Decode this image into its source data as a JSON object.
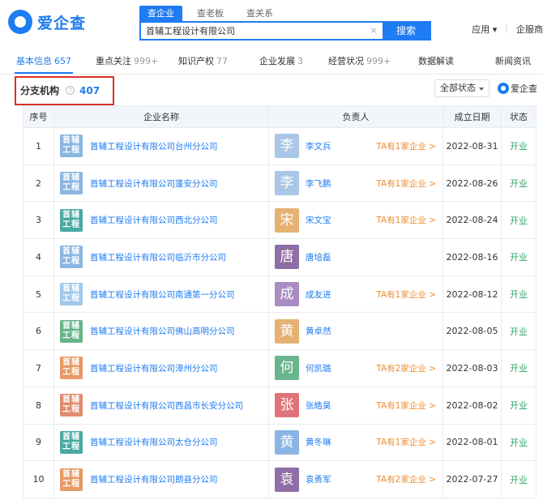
{
  "header": {
    "logo_text": "爱企查",
    "search_tabs": [
      "查企业",
      "查老板",
      "查关系"
    ],
    "search_value": "首辅工程设计有限公司",
    "search_button": "搜索",
    "clear_icon": "×",
    "right_items": [
      "应用",
      "企服商"
    ]
  },
  "nav": {
    "tabs": [
      {
        "label": "基本信息",
        "count": "657"
      },
      {
        "label": "重点关注",
        "count": "999+"
      },
      {
        "label": "知识产权",
        "count": "77"
      },
      {
        "label": "企业发展",
        "count": "3"
      },
      {
        "label": "经营状况",
        "count": "999+"
      },
      {
        "label": "数据解读",
        "count": ""
      },
      {
        "label": "新闻资讯",
        "count": ""
      }
    ]
  },
  "section": {
    "title": "分支机构",
    "help": "?",
    "count": "407",
    "status_filter": "全部状态",
    "watermark": "爱企查"
  },
  "table": {
    "headers": [
      "序号",
      "企业名称",
      "负责人",
      "成立日期",
      "状态"
    ],
    "logo_text": [
      "首辅",
      "工程"
    ],
    "rows": [
      {
        "no": "1",
        "company": "首辅工程设计有限公司台州分公司",
        "logo_color": "#8bb6e0",
        "avatar": "李",
        "avatar_color": "#a9c6e6",
        "person": "李文兵",
        "ta": "TA有1家企业 >",
        "date": "2022-08-31",
        "status": "开业"
      },
      {
        "no": "2",
        "company": "首辅工程设计有限公司蓬安分公司",
        "logo_color": "#8bb6e0",
        "avatar": "李",
        "avatar_color": "#a9c6e6",
        "person": "李飞鹏",
        "ta": "TA有1家企业 >",
        "date": "2022-08-26",
        "status": "开业"
      },
      {
        "no": "3",
        "company": "首辅工程设计有限公司西北分公司",
        "logo_color": "#4aa9a3",
        "avatar": "宋",
        "avatar_color": "#e5b274",
        "person": "宋文宝",
        "ta": "TA有1家企业 >",
        "date": "2022-08-24",
        "status": "开业"
      },
      {
        "no": "4",
        "company": "首辅工程设计有限公司临沂市分公司",
        "logo_color": "#8bb6e0",
        "avatar": "唐",
        "avatar_color": "#8e6ea5",
        "person": "唐培磊",
        "ta": "",
        "date": "2022-08-16",
        "status": "开业"
      },
      {
        "no": "5",
        "company": "首辅工程设计有限公司南通第一分公司",
        "logo_color": "#9ec9ec",
        "avatar": "成",
        "avatar_color": "#a98cc2",
        "person": "成友进",
        "ta": "TA有1家企业 >",
        "date": "2022-08-12",
        "status": "开业"
      },
      {
        "no": "6",
        "company": "首辅工程设计有限公司佛山高明分公司",
        "logo_color": "#67b58a",
        "avatar": "黄",
        "avatar_color": "#e5b274",
        "person": "黄卓然",
        "ta": "",
        "date": "2022-08-05",
        "status": "开业"
      },
      {
        "no": "7",
        "company": "首辅工程设计有限公司漳州分公司",
        "logo_color": "#e69a66",
        "avatar": "何",
        "avatar_color": "#69b58e",
        "person": "何凯璐",
        "ta": "TA有2家企业 >",
        "date": "2022-08-03",
        "status": "开业"
      },
      {
        "no": "8",
        "company": "首辅工程设计有限公司西昌市长安分公司",
        "logo_color": "#e28a6e",
        "avatar": "张",
        "avatar_color": "#e0737a",
        "person": "张皓昊",
        "ta": "TA有1家企业 >",
        "date": "2022-08-02",
        "status": "开业"
      },
      {
        "no": "9",
        "company": "首辅工程设计有限公司太仓分公司",
        "logo_color": "#4aa9a3",
        "avatar": "黄",
        "avatar_color": "#8ab4e3",
        "person": "黄冬琳",
        "ta": "TA有1家企业 >",
        "date": "2022-08-01",
        "status": "开业"
      },
      {
        "no": "10",
        "company": "首辅工程设计有限公司朗县分公司",
        "logo_color": "#e69a66",
        "avatar": "袁",
        "avatar_color": "#8e6ea5",
        "person": "袁勇军",
        "ta": "TA有2家企业 >",
        "date": "2022-07-27",
        "status": "开业"
      }
    ]
  }
}
